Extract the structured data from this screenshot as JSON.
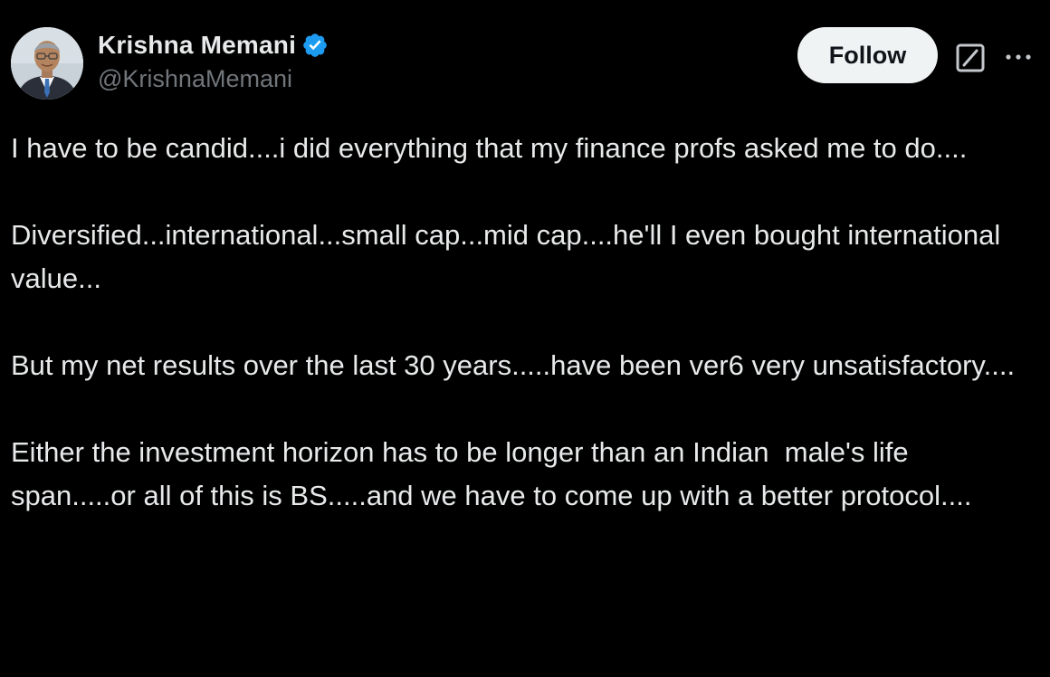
{
  "author": {
    "display_name": "Krishna Memani",
    "handle": "@KrishnaMemani",
    "verified": true,
    "verified_color": "#1d9bf0"
  },
  "actions": {
    "follow_label": "Follow"
  },
  "icons": {
    "avatar": "profile-photo",
    "verified": "verified-badge-icon",
    "grok": "grok-icon",
    "more": "more-options-icon"
  },
  "tweet": {
    "paragraphs": [
      "I have to be candid....i did everything that my finance profs asked me to do....",
      "Diversified...international...small cap...mid cap....he'll I even bought international value...",
      "But my net results over the last 30 years.....have been ver6 very unsatisfactory....",
      "Either the investment horizon has to be longer than an Indian  male's life span.....or all of this is BS.....and we have to come up with a better protocol...."
    ]
  },
  "colors": {
    "background": "#000000",
    "text_primary": "#e7e9ea",
    "text_secondary": "#71767b",
    "follow_bg": "#eff3f4",
    "follow_text": "#0f1419"
  }
}
